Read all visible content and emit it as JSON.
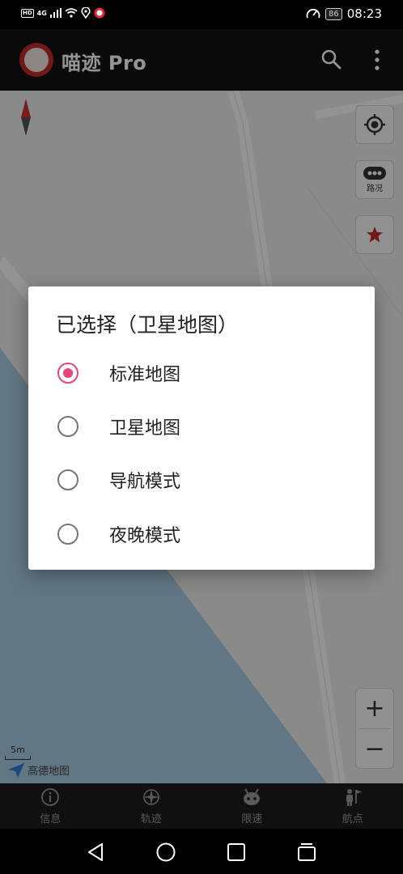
{
  "status_bar": {
    "hd": "HD",
    "network": "4G",
    "battery": "86",
    "time": "08:23"
  },
  "app_bar": {
    "title": "喵迹 Pro",
    "icons": [
      "app-logo",
      "search-icon",
      "more-vert-icon"
    ]
  },
  "map": {
    "traffic_label": "路况",
    "scale_label": "5m",
    "attribution": "高德地图",
    "zoom_in": "+",
    "zoom_out": "−",
    "colors": {
      "land": "#eeeeee",
      "water": "#a9cde3",
      "favorite": "#c62828"
    }
  },
  "dialog": {
    "title": "已选择（卫星地图）",
    "options": [
      {
        "label": "标准地图",
        "selected": true
      },
      {
        "label": "卫星地图",
        "selected": false
      },
      {
        "label": "导航模式",
        "selected": false
      },
      {
        "label": "夜晚模式",
        "selected": false
      }
    ],
    "accent": "#e8457a"
  },
  "bottom_nav": {
    "items": [
      {
        "label": "信息",
        "icon": "info-icon"
      },
      {
        "label": "轨迹",
        "icon": "compass-icon"
      },
      {
        "label": "限速",
        "icon": "mascot-icon"
      },
      {
        "label": "航点",
        "icon": "person-flag-icon"
      }
    ]
  },
  "system_nav": [
    "back-icon",
    "home-icon",
    "recents-icon",
    "switch-icon"
  ]
}
